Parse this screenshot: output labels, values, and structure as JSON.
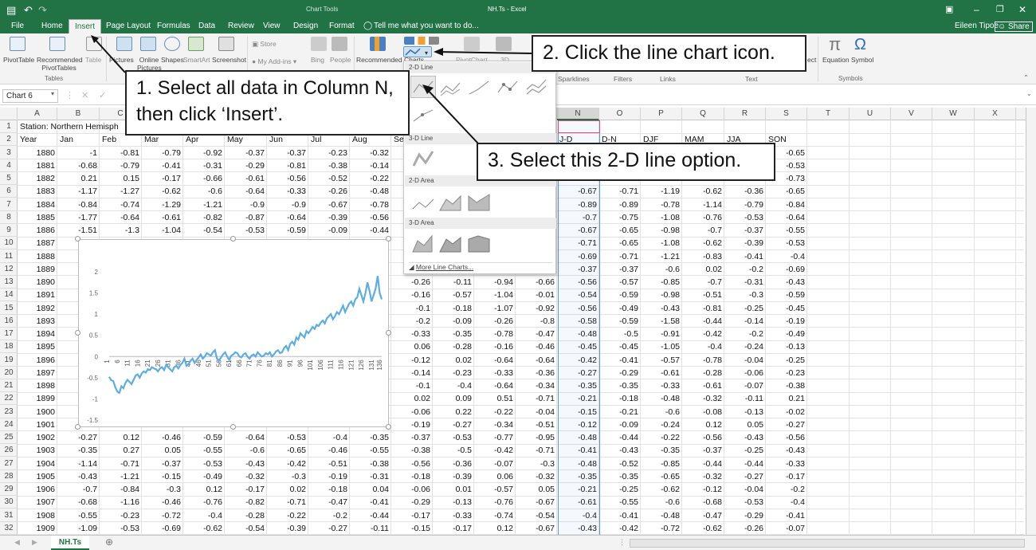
{
  "window": {
    "title": "NH.Ts - Excel",
    "context_tab": "Chart Tools",
    "user": "Eileen Tipoe",
    "share": "Share"
  },
  "tabs": [
    "File",
    "Home",
    "Insert",
    "Page Layout",
    "Formulas",
    "Data",
    "Review",
    "View",
    "Design",
    "Format"
  ],
  "tell_me": "Tell me what you want to do...",
  "ribbon": {
    "pivottable": "PivotTable",
    "recommended_pivot": "Recommended PivotTables",
    "table": "Table",
    "tables_group": "Tables",
    "pictures": "Pictures",
    "online_pictures": "Online Pictures",
    "shapes": "Shapes",
    "smartart": "SmartArt",
    "screenshot": "Screenshot",
    "store": "Store",
    "my_addins": "My Add-ins",
    "bing": "Bing",
    "people": "People",
    "recommended_charts": "Recommended Charts",
    "pivotchart": "PivotChart",
    "three_d": "3D",
    "sparklines": "Sparklines",
    "filters": "Filters",
    "links": "Links",
    "text": "Text",
    "equation": "Equation",
    "symbol": "Symbol",
    "symbols_group": "Symbols",
    "ect": "ect"
  },
  "name_box": "Chart 6",
  "columns": [
    "A",
    "B",
    "C",
    "D",
    "E",
    "F",
    "G",
    "H",
    "I",
    "J",
    "K",
    "L",
    "M",
    "N",
    "O",
    "P",
    "Q",
    "R",
    "S",
    "T",
    "U",
    "V",
    "W",
    "X"
  ],
  "row1_label": "Station: Northern Hemisph",
  "headers_left": [
    "Year",
    "Jan",
    "Feb",
    "Mar",
    "Apr",
    "May",
    "Jun",
    "Jul",
    "Aug",
    "Se"
  ],
  "headers_right": [
    "J-D",
    "D-N",
    "DJF",
    "MAM",
    "JJA",
    "SON"
  ],
  "rows_left": [
    [
      "1880",
      "-1",
      "-0.81",
      "-0.79",
      "-0.92",
      "-0.37",
      "-0.37",
      "-0.23",
      "-0.32"
    ],
    [
      "1881",
      "-0.68",
      "-0.79",
      "-0.41",
      "-0.31",
      "-0.29",
      "-0.81",
      "-0.38",
      "-0.14"
    ],
    [
      "1882",
      "0.21",
      "0.15",
      "-0.17",
      "-0.66",
      "-0.61",
      "-0.56",
      "-0.52",
      "-0.22"
    ],
    [
      "1883",
      "-1.17",
      "-1.27",
      "-0.62",
      "-0.6",
      "-0.64",
      "-0.33",
      "-0.26",
      "-0.48"
    ],
    [
      "1884",
      "-0.84",
      "-0.74",
      "-1.29",
      "-1.21",
      "-0.9",
      "-0.9",
      "-0.67",
      "-0.78"
    ],
    [
      "1885",
      "-1.77",
      "-0.64",
      "-0.61",
      "-0.82",
      "-0.87",
      "-0.64",
      "-0.39",
      "-0.56"
    ],
    [
      "1886",
      "-1.51",
      "-1.3",
      "-1.04",
      "-0.54",
      "-0.53",
      "-0.59",
      "-0.09",
      "-0.44"
    ],
    [
      "1887"
    ],
    [
      "1888"
    ],
    [
      "1889"
    ],
    [
      "1890"
    ],
    [
      "1891"
    ],
    [
      "1892"
    ],
    [
      "1893"
    ],
    [
      "1894"
    ],
    [
      "1895"
    ],
    [
      "1896"
    ],
    [
      "1897"
    ],
    [
      "1898"
    ],
    [
      "1899"
    ],
    [
      "1900"
    ],
    [
      "1901"
    ],
    [
      "1902",
      "-0.27",
      "0.12",
      "-0.46",
      "-0.59",
      "-0.64",
      "-0.53",
      "-0.4",
      "-0.35"
    ],
    [
      "1903",
      "-0.35",
      "0.27",
      "0.05",
      "-0.55",
      "-0.6",
      "-0.65",
      "-0.46",
      "-0.55"
    ],
    [
      "1904",
      "-1.14",
      "-0.71",
      "-0.37",
      "-0.53",
      "-0.43",
      "-0.42",
      "-0.51",
      "-0.38"
    ],
    [
      "1905",
      "-0.43",
      "-1.21",
      "-0.15",
      "-0.49",
      "-0.32",
      "-0.3",
      "-0.19",
      "-0.31"
    ],
    [
      "1906",
      "-0.7",
      "-0.84",
      "-0.3",
      "0.12",
      "-0.17",
      "0.02",
      "-0.18",
      "0.04"
    ],
    [
      "1907",
      "-0.68",
      "-1.16",
      "-0.46",
      "-0.76",
      "-0.82",
      "-0.71",
      "-0.47",
      "-0.41"
    ],
    [
      "1908",
      "-0.55",
      "-0.23",
      "-0.72",
      "-0.4",
      "-0.28",
      "-0.22",
      "-0.2",
      "-0.44"
    ],
    [
      "1909",
      "-1.09",
      "-0.53",
      "-0.69",
      "-0.62",
      "-0.54",
      "-0.39",
      "-0.27",
      "-0.11"
    ]
  ],
  "rows_mid": [
    [],
    [],
    [],
    [],
    [],
    [],
    [],
    [],
    [],
    [],
    [
      "-0.26",
      "-0.11",
      "-0.94",
      "-0.66"
    ],
    [
      "-0.16",
      "-0.57",
      "-1.04",
      "-0.01"
    ],
    [
      "-0.1",
      "-0.18",
      "-1.07",
      "-0.92"
    ],
    [
      "-0.2",
      "-0.09",
      "-0.26",
      "-0.8"
    ],
    [
      "-0.33",
      "-0.35",
      "-0.78",
      "-0.47"
    ],
    [
      "0.06",
      "-0.28",
      "-0.16",
      "-0.46"
    ],
    [
      "-0.12",
      "0.02",
      "-0.64",
      "-0.64"
    ],
    [
      "-0.14",
      "-0.23",
      "-0.33",
      "-0.36"
    ],
    [
      "-0.1",
      "-0.4",
      "-0.64",
      "-0.34"
    ],
    [
      "0.02",
      "0.09",
      "0.51",
      "-0.71"
    ],
    [
      "-0.06",
      "0.22",
      "-0.22",
      "-0.04"
    ],
    [
      "-0.19",
      "-0.27",
      "-0.34",
      "-0.51"
    ],
    [
      "-0.37",
      "-0.53",
      "-0.77",
      "-0.95"
    ],
    [
      "-0.38",
      "-0.5",
      "-0.42",
      "-0.71"
    ],
    [
      "-0.56",
      "-0.36",
      "-0.07",
      "-0.3"
    ],
    [
      "-0.18",
      "-0.39",
      "0.06",
      "-0.32"
    ],
    [
      "-0.06",
      "0.01",
      "-0.57",
      "0.05"
    ],
    [
      "-0.29",
      "-0.13",
      "-0.76",
      "-0.67"
    ],
    [
      "-0.17",
      "-0.33",
      "-0.74",
      "-0.54"
    ],
    [
      "-0.15",
      "-0.17",
      "0.12",
      "-0.67"
    ]
  ],
  "rows_right": [
    [
      "",
      "",
      "",
      "",
      "",
      "-0.65"
    ],
    [
      "",
      "",
      "",
      "",
      "",
      "-0.53"
    ],
    [
      "",
      "",
      "",
      "",
      "",
      "-0.73"
    ],
    [
      "-0.67",
      "-0.71",
      "-1.19",
      "-0.62",
      "-0.36",
      "-0.65"
    ],
    [
      "-0.89",
      "-0.89",
      "-0.78",
      "-1.14",
      "-0.79",
      "-0.84"
    ],
    [
      "-0.7",
      "-0.75",
      "-1.08",
      "-0.76",
      "-0.53",
      "-0.64"
    ],
    [
      "-0.67",
      "-0.65",
      "-0.98",
      "-0.7",
      "-0.37",
      "-0.55"
    ],
    [
      "-0.71",
      "-0.65",
      "-1.08",
      "-0.62",
      "-0.39",
      "-0.53"
    ],
    [
      "-0.69",
      "-0.71",
      "-1.21",
      "-0.83",
      "-0.41",
      "-0.4"
    ],
    [
      "-0.37",
      "-0.37",
      "-0.6",
      "0.02",
      "-0.2",
      "-0.69"
    ],
    [
      "-0.56",
      "-0.57",
      "-0.85",
      "-0.7",
      "-0.31",
      "-0.43"
    ],
    [
      "-0.54",
      "-0.59",
      "-0.98",
      "-0.51",
      "-0.3",
      "-0.59"
    ],
    [
      "-0.56",
      "-0.49",
      "-0.43",
      "-0.81",
      "-0.25",
      "-0.45"
    ],
    [
      "-0.58",
      "-0.59",
      "-1.58",
      "-0.44",
      "-0.14",
      "-0.19"
    ],
    [
      "-0.48",
      "-0.5",
      "-0.91",
      "-0.42",
      "-0.2",
      "-0.49"
    ],
    [
      "-0.45",
      "-0.45",
      "-1.05",
      "-0.4",
      "-0.24",
      "-0.13"
    ],
    [
      "-0.42",
      "-0.41",
      "-0.57",
      "-0.78",
      "-0.04",
      "-0.25"
    ],
    [
      "-0.27",
      "-0.29",
      "-0.61",
      "-0.28",
      "-0.06",
      "-0.23"
    ],
    [
      "-0.35",
      "-0.35",
      "-0.33",
      "-0.61",
      "-0.07",
      "-0.38"
    ],
    [
      "-0.21",
      "-0.18",
      "-0.48",
      "-0.32",
      "-0.11",
      "0.21"
    ],
    [
      "-0.15",
      "-0.21",
      "-0.6",
      "-0.08",
      "-0.13",
      "-0.02"
    ],
    [
      "-0.12",
      "-0.09",
      "-0.24",
      "0.12",
      "0.05",
      "-0.27"
    ],
    [
      "-0.48",
      "-0.44",
      "-0.22",
      "-0.56",
      "-0.43",
      "-0.56"
    ],
    [
      "-0.41",
      "-0.43",
      "-0.35",
      "-0.37",
      "-0.25",
      "-0.43"
    ],
    [
      "-0.48",
      "-0.52",
      "-0.85",
      "-0.44",
      "-0.44",
      "-0.33"
    ],
    [
      "-0.35",
      "-0.35",
      "-0.65",
      "-0.32",
      "-0.27",
      "-0.17"
    ],
    [
      "-0.21",
      "-0.25",
      "-0.62",
      "-0.12",
      "-0.04",
      "-0.2"
    ],
    [
      "-0.61",
      "-0.55",
      "-0.6",
      "-0.68",
      "-0.53",
      "-0.4"
    ],
    [
      "-0.4",
      "-0.41",
      "-0.48",
      "-0.47",
      "-0.29",
      "-0.41"
    ],
    [
      "-0.43",
      "-0.42",
      "-0.72",
      "-0.62",
      "-0.26",
      "-0.07"
    ]
  ],
  "dropdown": {
    "line2d": "2-D Line",
    "line3d": "3-D Line",
    "area2d": "2-D Area",
    "area3d": "3-D Area",
    "more": "More Line Charts..."
  },
  "callouts": {
    "step1": "1. Select all data in Column N, then click ‘Insert’.",
    "step2": "2. Click the line chart icon.",
    "step3": "3. Select this 2-D line option."
  },
  "sheet_tab": "NH.Ts",
  "chart_data": {
    "type": "line",
    "ylim": [
      -1.5,
      2
    ],
    "yticks": [
      "2",
      "1.5",
      "1",
      "0.5",
      "0",
      "-0.5",
      "-1",
      "-1.5"
    ],
    "xticks": [
      "1",
      "6",
      "11",
      "16",
      "21",
      "26",
      "31",
      "36",
      "41",
      "46",
      "51",
      "56",
      "61",
      "66",
      "71",
      "76",
      "81",
      "86",
      "91",
      "96",
      "101",
      "106",
      "111",
      "116",
      "121",
      "126",
      "131",
      "136"
    ],
    "color": "#5dade2",
    "series": [
      {
        "values": [
          -0.48,
          -0.56,
          -0.58,
          -0.72,
          -0.83,
          -0.86,
          -0.7,
          -0.75,
          -0.62,
          -0.55,
          -0.6,
          -0.65,
          -0.55,
          -0.45,
          -0.42,
          -0.5,
          -0.4,
          -0.35,
          -0.38,
          -0.3,
          -0.32,
          -0.25,
          -0.28,
          -0.3,
          -0.35,
          -0.28,
          -0.25,
          -0.32,
          -0.2,
          -0.25,
          -0.3,
          -0.35,
          -0.25,
          -0.22,
          -0.28,
          -0.2,
          -0.15,
          -0.05,
          -0.22,
          -0.18,
          -0.1,
          -0.05,
          -0.15,
          -0.08,
          -0.02,
          0.05,
          -0.05,
          0.0,
          0.08,
          0.05,
          0.02,
          0.1,
          0.15,
          -0.05,
          -0.1,
          -0.02,
          0.05,
          0.1,
          0.0,
          -0.08,
          0.02,
          0.05,
          0.1,
          0.08,
          0.0,
          -0.02,
          0.05,
          0.08,
          0.0,
          -0.05,
          0.02,
          0.05,
          0.0,
          0.1,
          0.05,
          0.0,
          0.02,
          0.08,
          0.05,
          0.1,
          0.0,
          0.05,
          0.12,
          0.15,
          0.08,
          0.1,
          0.2,
          0.25,
          0.15,
          0.3,
          0.35,
          0.28,
          0.45,
          0.4,
          0.55,
          0.5,
          0.45,
          0.6,
          0.55,
          0.62,
          0.7,
          0.65,
          0.75,
          0.72,
          0.8,
          0.85,
          0.78,
          0.9,
          0.95,
          1.0,
          0.88,
          0.95,
          1.05,
          1.0,
          1.1,
          1.2,
          1.05,
          1.15,
          1.25,
          1.3,
          1.2,
          1.35,
          1.4,
          1.6,
          1.45,
          1.3,
          1.5,
          1.75,
          1.55,
          1.3,
          1.45,
          1.6,
          1.9,
          1.5,
          1.35
        ]
      }
    ]
  }
}
